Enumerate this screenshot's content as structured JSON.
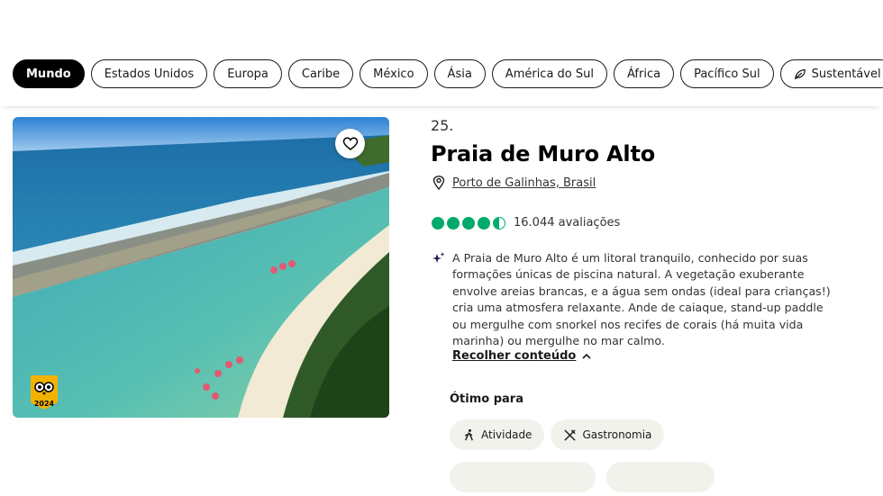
{
  "filters": {
    "chips": [
      {
        "label": "Mundo",
        "active": true
      },
      {
        "label": "Estados Unidos"
      },
      {
        "label": "Europa"
      },
      {
        "label": "Caribe"
      },
      {
        "label": "México"
      },
      {
        "label": "Ásia"
      },
      {
        "label": "América do Sul"
      },
      {
        "label": "África"
      },
      {
        "label": "Pacífico Sul"
      },
      {
        "label": "Sustentável",
        "icon": "leaf-icon"
      }
    ]
  },
  "listing": {
    "rank": "25.",
    "title": "Praia de Muro Alto",
    "location": "Porto de Galinhas, Brasil",
    "rating": 4.5,
    "reviews": "16.044 avaliações",
    "description": "A Praia de Muro Alto é um litoral tranquilo, conhecido por suas formações únicas de piscina natural. A vegetação exuberante envolve areias brancas, e a água sem ondas (ideal para crianças!) cria uma atmosfera relaxante. Ande de caiaque, stand-up paddle ou mergulhe com snorkel nos recifes de corais (há muita vida marinha) ou mergulhe no mar calmo.",
    "collapse_label": "Recolher conteúdo",
    "badge_year": "2024",
    "good_for_label": "Ótimo para",
    "tags": [
      {
        "label": "Atividade",
        "icon": "hiker-icon"
      },
      {
        "label": "Gastronomia",
        "icon": "utensils-icon"
      }
    ]
  },
  "colors": {
    "rating_green": "#00aa6c",
    "badge_yellow": "#f2b203",
    "tag_bg": "#f2f2ec"
  }
}
